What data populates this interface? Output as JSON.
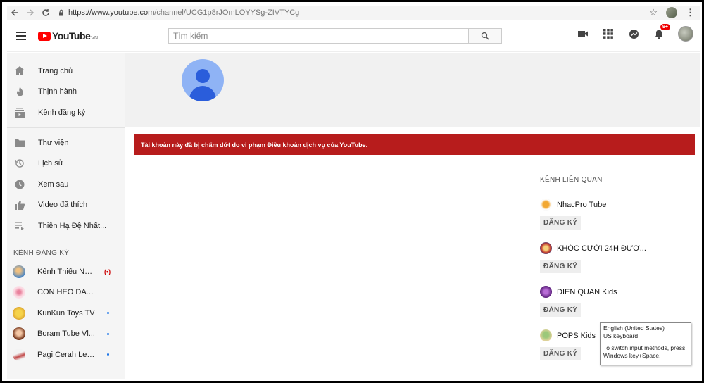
{
  "browser": {
    "url_host": "https://www.youtube.com",
    "url_path": "/channel/UCG1p8rJOmLOYYSg-ZIVTYCg"
  },
  "header": {
    "logo_text": "YouTube",
    "logo_region": "VN",
    "search_placeholder": "Tìm kiếm",
    "notifications_badge": "9+"
  },
  "sidebar": {
    "main_items": [
      {
        "label": "Trang chủ",
        "icon": "home-icon"
      },
      {
        "label": "Thịnh hành",
        "icon": "flame-icon"
      },
      {
        "label": "Kênh đăng ký",
        "icon": "subscriptions-icon"
      }
    ],
    "library_items": [
      {
        "label": "Thư viện",
        "icon": "folder-icon"
      },
      {
        "label": "Lịch sử",
        "icon": "history-icon"
      },
      {
        "label": "Xem sau",
        "icon": "clock-icon"
      },
      {
        "label": "Video đã thích",
        "icon": "thumbs-up-icon"
      },
      {
        "label": "Thiên Hạ Đệ Nhất...",
        "icon": "playlist-icon"
      }
    ],
    "subscriptions_heading": "KÊNH ĐĂNG KÝ",
    "channels": [
      {
        "label": "Kênh Thiếu Nhi...",
        "indicator": "live"
      },
      {
        "label": "CON HEO DAT TV",
        "indicator": "none"
      },
      {
        "label": "KunKun Toys TV",
        "indicator": "new"
      },
      {
        "label": "Boram Tube Vl...",
        "indicator": "new"
      },
      {
        "label": "Pagi Cerah Let...",
        "indicator": "new"
      }
    ]
  },
  "main": {
    "alert_text": "Tài khoản này đã bị chấm dứt do vi phạm Điều khoản dịch vụ của YouTube.",
    "related_heading": "KÊNH LIÊN QUAN",
    "related_channels": [
      {
        "name": "NhacPro Tube",
        "subscribe_label": "ĐĂNG KÝ"
      },
      {
        "name": "KHÓC CƯỜI 24H ĐƯỢ...",
        "subscribe_label": "ĐĂNG KÝ"
      },
      {
        "name": "DIEN QUAN Kids",
        "subscribe_label": "ĐĂNG KÝ"
      },
      {
        "name": "POPS Kids",
        "subscribe_label": "ĐĂNG KÝ"
      }
    ]
  },
  "tooltip": {
    "line1": "English (United States)",
    "line2": "US keyboard",
    "line3": "To switch input methods, press",
    "line4": "Windows key+Space."
  },
  "colors": {
    "brand_red": "#ff0000",
    "alert_red": "#b71c1c",
    "avatar_blue": "#8fb3f5"
  }
}
